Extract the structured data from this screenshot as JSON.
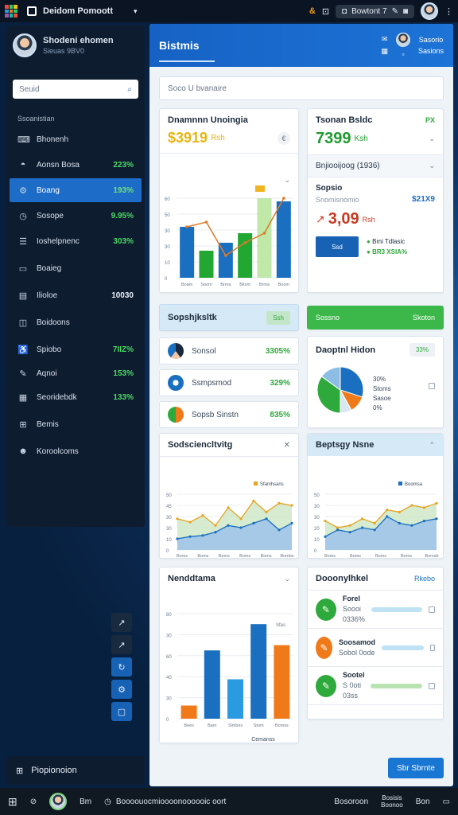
{
  "window": {
    "title": "Deidom Pomoott",
    "tab_label": "Bowtont 7",
    "icon": "app-grid-icon"
  },
  "sidebar": {
    "profile": {
      "name": "Shodeni ehomen",
      "sub": "Sieuas 9BV0"
    },
    "search_placeholder": "Seuid",
    "section": "Ssoanistian",
    "items": [
      {
        "icon": "terminal-icon",
        "label": "Bhonenh",
        "value": ""
      },
      {
        "icon": "hat-icon",
        "label": "Aonsn Bosa",
        "value": "223%"
      },
      {
        "icon": "gear-icon",
        "label": "Boang",
        "value": "193%"
      },
      {
        "icon": "clock-icon",
        "label": "Sosope",
        "value": "9.95%"
      },
      {
        "icon": "list-icon",
        "label": "Ioshelpnenc",
        "value": "303%"
      },
      {
        "icon": "folder-icon",
        "label": "Boaieg",
        "value": ""
      },
      {
        "icon": "doc-icon",
        "label": "Ilioloe",
        "value": "10030"
      },
      {
        "icon": "book-icon",
        "label": "Boidoons",
        "value": ""
      },
      {
        "icon": "user-icon",
        "label": "Spiobo",
        "value": "7IIZ%"
      },
      {
        "icon": "pen-icon",
        "label": "Aqnoi",
        "value": "153%"
      },
      {
        "icon": "calendar-icon",
        "label": "Seoridebdk",
        "value": "133%"
      },
      {
        "icon": "grid-icon",
        "label": "Bemis",
        "value": ""
      },
      {
        "icon": "user-group-icon",
        "label": "Koroolcoms",
        "value": ""
      }
    ],
    "footer_label": "Piopionoion"
  },
  "header": {
    "title": "Bistmis",
    "right_a": "Sasorio",
    "right_b": "Sasions"
  },
  "main_search_placeholder": "Soco U bvanaire",
  "card_bar": {
    "title": "Dnamnnn Unoingia",
    "amount": "$3919",
    "amount_suffix": "Rsh",
    "chart_data": {
      "type": "bar",
      "categories": [
        "Boam",
        "Soom",
        "Brma",
        "Bitsm",
        "Brma",
        "Boom"
      ],
      "values": [
        32,
        17,
        22,
        28,
        50,
        48
      ],
      "line": [
        32,
        35,
        14,
        22,
        28,
        50
      ],
      "ylim": [
        0,
        50
      ],
      "yticks": [
        "0",
        "10",
        "30",
        "30",
        "50",
        "60"
      ],
      "colors": [
        "#1a6fc0",
        "#22a832",
        "#1a6fc0",
        "#22a832",
        "#bfe8a9",
        "#1a6fc0"
      ]
    }
  },
  "card_kpi": {
    "title": "Tsonan Bsldc",
    "badge": "PX",
    "value": "7399",
    "value_suffix": "Ksh",
    "row2": "Bnjiooijoog (1936)",
    "sub_title": "Sopsio",
    "sub_value": "$21X9",
    "sub_line": "Snomisnomio",
    "amount": "3,09",
    "amount_suffix": "Rsh",
    "button_label": "Ssd",
    "legend1": "Bmi Tdlasic",
    "legend2": "BR3 XSIA%"
  },
  "list_card": {
    "header": "Sopshjksltk",
    "header_badge": "Ssh",
    "rows": [
      {
        "label": "Sonsol",
        "value": "3305%"
      },
      {
        "label": "Ssmpsmod",
        "value": "329%"
      },
      {
        "label": "Sopsb Sinstn",
        "value": "835%"
      }
    ]
  },
  "pie_card": {
    "header": "Sossno",
    "header_badge": "Skoton",
    "title": "Daoptnl Hidon",
    "badge": "33%",
    "legend": [
      "30%",
      "Stoms",
      "Sasoe",
      "0%"
    ],
    "chart_data": {
      "type": "pie",
      "values": [
        30,
        12,
        8,
        35,
        15
      ],
      "colors": [
        "#1a6fc0",
        "#f07a1a",
        "#d9e7f3",
        "#2eaa3c",
        "#8dbde4"
      ]
    }
  },
  "area_card_left": {
    "title": "Sodsciencltvitg",
    "legend": [
      "Sfanihsans"
    ],
    "chart_data": {
      "type": "area",
      "categories": [
        "Boms",
        "Boms",
        "Boms",
        "Boms",
        "Boms",
        "Bombs"
      ],
      "series": [
        {
          "values": [
            28,
            25,
            31,
            22,
            38,
            28,
            44,
            34,
            42,
            40
          ]
        },
        {
          "values": [
            10,
            12,
            13,
            16,
            22,
            20,
            24,
            28,
            18,
            24
          ]
        }
      ],
      "ylim": [
        0,
        50
      ],
      "yticks": [
        "0",
        "10",
        "30",
        "30",
        "45",
        "50"
      ]
    }
  },
  "area_card_right": {
    "title": "Beptsgy Nsne",
    "legend": [
      "Boomsa"
    ],
    "chart_data": {
      "type": "area",
      "categories": [
        "Boms",
        "Boms",
        "Boms",
        "Boms",
        "Bomsb"
      ],
      "series": [
        {
          "values": [
            26,
            20,
            22,
            28,
            24,
            36,
            34,
            40,
            38,
            42
          ]
        },
        {
          "values": [
            12,
            18,
            16,
            20,
            18,
            30,
            24,
            22,
            26,
            28
          ]
        }
      ],
      "ylim": [
        0,
        50
      ],
      "yticks": [
        "0",
        "10",
        "20",
        "30",
        "30",
        "50"
      ]
    }
  },
  "bar_card_big": {
    "title": "Nenddtama",
    "legend": "Sfas",
    "xlabel": "Cemanss",
    "chart_data": {
      "type": "bar",
      "categories": [
        "Bees",
        "Bam",
        "Slmbes",
        "Stom",
        "Bomss"
      ],
      "values": [
        10,
        52,
        30,
        72,
        56
      ],
      "ylim": [
        0,
        80
      ],
      "yticks": [
        "0",
        "30",
        "40",
        "60",
        "30",
        "80"
      ],
      "colors": [
        "#f07a1a",
        "#1a6fc0",
        "#2a9be0",
        "#1a6fc0",
        "#f07a1a"
      ]
    }
  },
  "tasks_card": {
    "title": "Dooonylhkel",
    "badge": "Rkebo",
    "rows": [
      {
        "title": "Forel",
        "sub": "Soooi 0336%",
        "color": "#2eaa3c",
        "bar": "#bfe3f5"
      },
      {
        "title": "Soosamod",
        "sub": "Sobol 0ode",
        "color": "#f07a1a",
        "bar": "#bfe3f5"
      },
      {
        "title": "Sootel",
        "sub": "S 0oti 03ss",
        "color": "#2eaa3c",
        "bar": "#b9e3b2"
      }
    ]
  },
  "fab_label": "Sbr Sbrnte",
  "taskbar": {
    "item1": "Bm",
    "item2": "Boooouocmioooonoooooic oort",
    "item3": "Bosoroon",
    "item4a": "Bosisis",
    "item4b": "Boonoo",
    "item5": "Bon"
  }
}
